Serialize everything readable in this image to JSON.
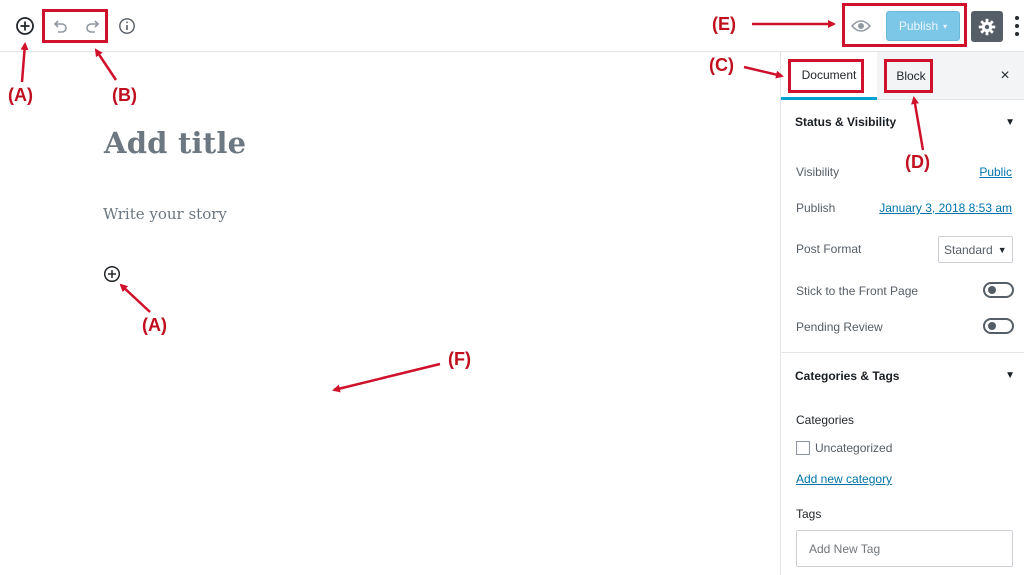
{
  "toolbar": {
    "add_block_icon": "plus-circle-icon",
    "undo_icon": "undo-icon",
    "redo_icon": "redo-icon",
    "info_icon": "info-icon",
    "preview_icon": "eye-icon",
    "publish_label": "Publish",
    "publish_caret": "▾",
    "settings_icon": "gear-icon",
    "more_icon": "vertical-ellipsis-icon"
  },
  "editor": {
    "title_placeholder": "Add title",
    "body_placeholder": "Write your story",
    "inline_add_icon": "plus-circle-icon"
  },
  "sidebar": {
    "tabs": [
      {
        "label": "Document",
        "active": true
      },
      {
        "label": "Block",
        "active": false
      }
    ],
    "close_label": "×",
    "status_panel": {
      "title": "Status & Visibility",
      "arrow": "▼",
      "visibility_label": "Visibility",
      "visibility_value": "Public",
      "publish_label": "Publish",
      "publish_value": "January 3, 2018 8:53 am",
      "post_format_label": "Post Format",
      "post_format_value": "Standard",
      "post_format_caret": "▼",
      "sticky_label": "Stick to the Front Page",
      "sticky_on": false,
      "pending_label": "Pending Review",
      "pending_on": false
    },
    "categories_panel": {
      "title": "Categories & Tags",
      "arrow": "▼",
      "categories_heading": "Categories",
      "categories": [
        {
          "name": "Uncategorized",
          "checked": false
        }
      ],
      "add_category_link": "Add new category",
      "tags_heading": "Tags",
      "tag_placeholder": "Add New Tag"
    }
  },
  "annotations": {
    "A_top": "(A)",
    "A_inline": "(A)",
    "B": "(B)",
    "C": "(C)",
    "D": "(D)",
    "E": "(E)",
    "F": "(F)",
    "color": "#d0112b"
  },
  "colors": {
    "accent": "#00a0d2",
    "publish_bg": "#7cc6e8",
    "settings_bg": "#555d66",
    "link": "#0073aa"
  }
}
